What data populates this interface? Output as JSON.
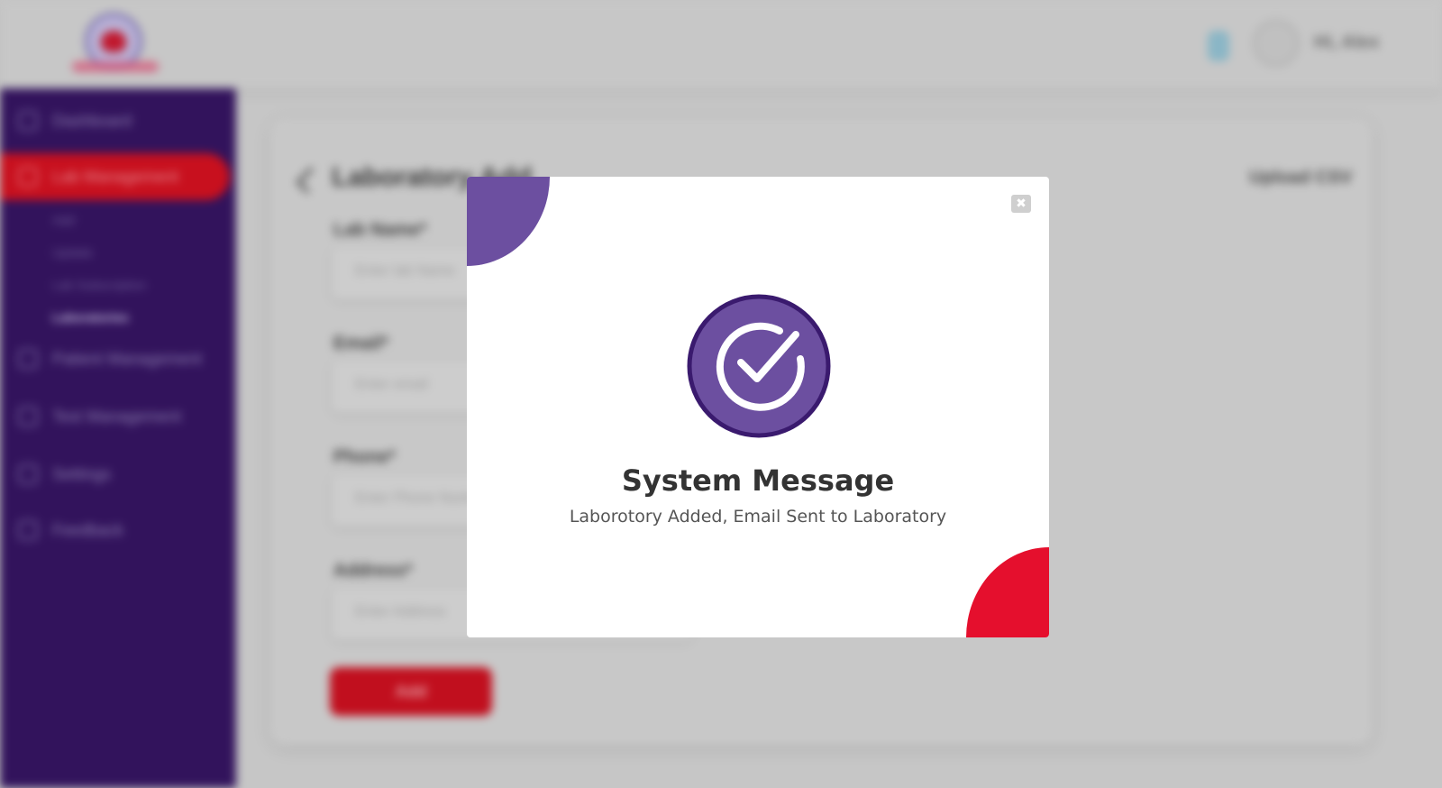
{
  "header": {
    "user_name": "Hi, Alex"
  },
  "sidebar": {
    "items": [
      {
        "label": "Dashboard",
        "icon": "grid-icon"
      },
      {
        "label": "Lab Management",
        "icon": "flask-icon",
        "active": true
      },
      {
        "label": "Patient Management",
        "icon": "users-icon"
      },
      {
        "label": "Test Management",
        "icon": "clipboard-icon"
      },
      {
        "label": "Settings",
        "icon": "gear-icon"
      },
      {
        "label": "Feedback",
        "icon": "message-icon"
      }
    ],
    "sub_items": [
      {
        "label": "Add"
      },
      {
        "label": "Update"
      },
      {
        "label": "Lab Subscription"
      },
      {
        "label": "Laboratories",
        "current": true
      }
    ]
  },
  "form": {
    "title": "Laboratory Add",
    "action": "Upload CSV",
    "fields": [
      {
        "label": "Lab Name*",
        "placeholder": "Enter lab Name"
      },
      {
        "label": "Email*",
        "placeholder": "Enter email"
      },
      {
        "label": "Phone*",
        "placeholder": "Enter Phone Number"
      },
      {
        "label": "Address*",
        "placeholder": "Enter Address"
      }
    ],
    "submit_label": "Add"
  },
  "modal": {
    "title": "System Message",
    "message": "Laborotory Added, Email Sent to Laboratory",
    "close_glyph": "✖",
    "icon": "check-circle-icon"
  },
  "colors": {
    "purple": "#6c4fa0",
    "dark_purple": "#32135c",
    "red": "#e50f2d",
    "white": "#ffffff"
  }
}
